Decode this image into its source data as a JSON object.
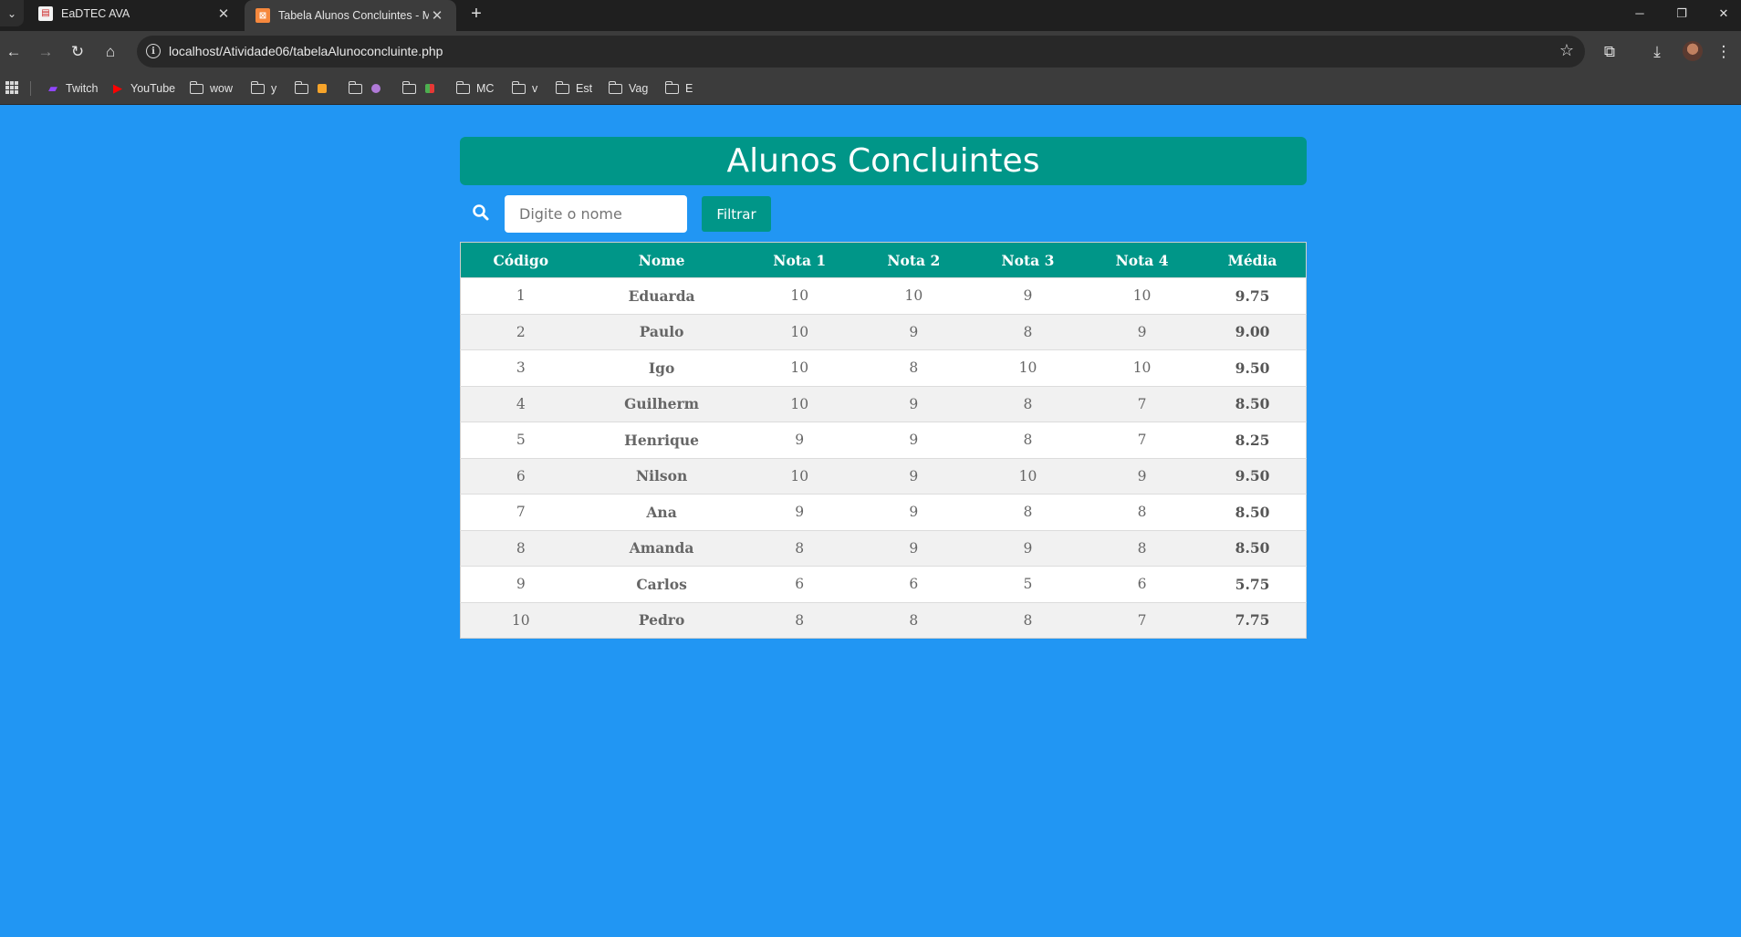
{
  "browser": {
    "tabs": [
      {
        "title": "EaDTEC AVA",
        "active": false
      },
      {
        "title": "Tabela Alunos Concluintes - MY",
        "active": true
      }
    ],
    "url": "localhost/Atividade06/tabelaAlunoconcluinte.php",
    "bookmarks": [
      {
        "label": "Twitch",
        "icon": "twitch-icon"
      },
      {
        "label": "YouTube",
        "icon": "youtube-icon"
      },
      {
        "label": "wow",
        "icon": "folder-icon"
      },
      {
        "label": "y",
        "icon": "folder-icon"
      },
      {
        "label": "",
        "icon": "folder-icon"
      },
      {
        "label": "",
        "icon": "folder-icon"
      },
      {
        "label": "",
        "icon": "folder-icon"
      },
      {
        "label": "MC",
        "icon": "folder-icon"
      },
      {
        "label": "v",
        "icon": "folder-icon"
      },
      {
        "label": "Est",
        "icon": "folder-icon"
      },
      {
        "label": "Vag",
        "icon": "folder-icon"
      },
      {
        "label": "E",
        "icon": "folder-icon"
      }
    ]
  },
  "page": {
    "title": "Alunos Concluintes",
    "search": {
      "placeholder": "Digite o nome",
      "value": ""
    },
    "filter_button": "Filtrar",
    "background_color": "#2196f3",
    "accent_color": "#009688",
    "table": {
      "headers": [
        "Código",
        "Nome",
        "Nota 1",
        "Nota 2",
        "Nota 3",
        "Nota 4",
        "Média"
      ],
      "rows": [
        [
          "1",
          "Eduarda",
          "10",
          "10",
          "9",
          "10",
          "9.75"
        ],
        [
          "2",
          "Paulo",
          "10",
          "9",
          "8",
          "9",
          "9.00"
        ],
        [
          "3",
          "Igo",
          "10",
          "8",
          "10",
          "10",
          "9.50"
        ],
        [
          "4",
          "Guilherm",
          "10",
          "9",
          "8",
          "7",
          "8.50"
        ],
        [
          "5",
          "Henrique",
          "9",
          "9",
          "8",
          "7",
          "8.25"
        ],
        [
          "6",
          "Nilson",
          "10",
          "9",
          "10",
          "9",
          "9.50"
        ],
        [
          "7",
          "Ana",
          "9",
          "9",
          "8",
          "8",
          "8.50"
        ],
        [
          "8",
          "Amanda",
          "8",
          "9",
          "9",
          "8",
          "8.50"
        ],
        [
          "9",
          "Carlos",
          "6",
          "6",
          "5",
          "6",
          "5.75"
        ],
        [
          "10",
          "Pedro",
          "8",
          "8",
          "8",
          "7",
          "7.75"
        ]
      ]
    }
  }
}
